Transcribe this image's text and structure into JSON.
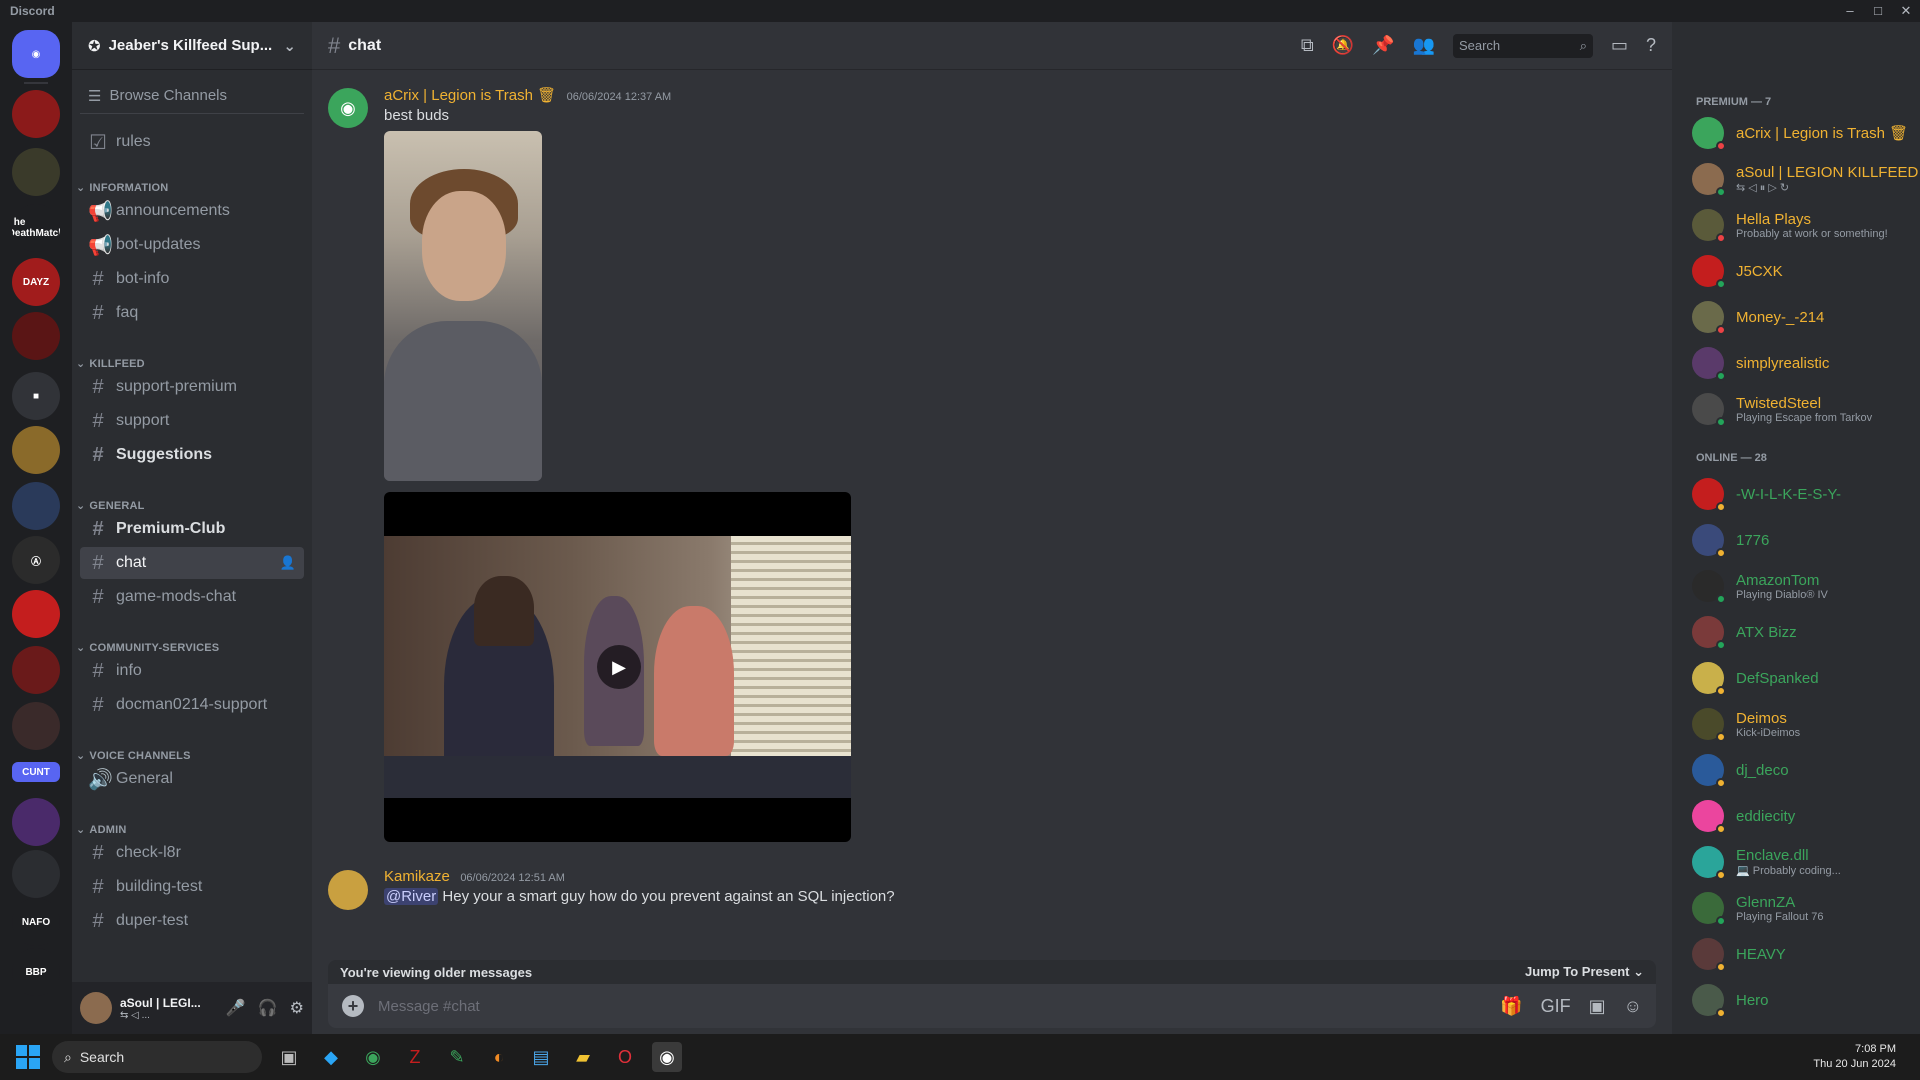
{
  "window": {
    "app_name": "Discord",
    "controls": [
      "–",
      "□",
      "✕"
    ]
  },
  "rail": {
    "servers": [
      {
        "name": "home",
        "label": "◉",
        "color": "#5865f2"
      },
      {
        "name": "server-1",
        "label": "",
        "color": "#8b1a1a"
      },
      {
        "name": "server-2",
        "label": "",
        "color": "#3a3a2a"
      },
      {
        "name": "server-3",
        "label": "The DeathMatch",
        "color": "#1e1f22"
      },
      {
        "name": "server-4",
        "label": "DAYZ",
        "color": "#a11c1c"
      },
      {
        "name": "server-5",
        "label": "",
        "color": "#5a1515"
      },
      {
        "name": "folder",
        "label": "■",
        "color": "#313338"
      },
      {
        "name": "server-6",
        "label": "",
        "color": "#8a6a2a"
      },
      {
        "name": "server-7",
        "label": "",
        "color": "#2a3a5a"
      },
      {
        "name": "server-8",
        "label": "Ⓐ",
        "color": "#2b2b2b"
      },
      {
        "name": "server-9",
        "label": "",
        "color": "#c41e1e"
      },
      {
        "name": "server-10",
        "label": "",
        "color": "#6a1a1a"
      },
      {
        "name": "server-11",
        "label": "",
        "color": "#3a2a2a"
      },
      {
        "name": "server-12",
        "label": "CUNT",
        "color": "#5865f2"
      },
      {
        "name": "server-13",
        "label": "",
        "color": "#4a2a6a"
      },
      {
        "name": "server-14",
        "label": "",
        "color": "#2b2d31"
      },
      {
        "name": "server-15",
        "label": "NAFO",
        "color": "#1e1f22"
      },
      {
        "name": "server-16",
        "label": "BBP",
        "color": "#1e1f22"
      }
    ]
  },
  "sidebar": {
    "guild_name": "Jeaber's Killfeed Sup...",
    "browse_channels": "Browse Channels",
    "rules": "rules",
    "categories": {
      "information": "INFORMATION",
      "killfeed": "KILLFEED",
      "general": "GENERAL",
      "community": "COMMUNITY-SERVICES",
      "voice": "VOICE CHANNELS",
      "admin": "ADMIN"
    },
    "channels": {
      "announcements": "announcements",
      "bot_updates": "bot-updates",
      "bot_info": "bot-info",
      "faq": "faq",
      "support_premium": "support-premium",
      "support": "support",
      "suggestions": "Suggestions",
      "premium_club": "Premium-Club",
      "chat": "chat",
      "game_mods_chat": "game-mods-chat",
      "info": "info",
      "docman": "docman0214-support",
      "voice_general": "General",
      "check_l8r": "check-l8r",
      "building_test": "building-test",
      "duper_test": "duper-test"
    }
  },
  "user_panel": {
    "name": "aSoul | LEGI...",
    "status": "⇆ ◁ ..."
  },
  "header": {
    "channel": "chat",
    "search_placeholder": "Search"
  },
  "messages": [
    {
      "author": "aCrix | Legion is Trash 🗑",
      "author_color": "#f0b232",
      "timestamp": "06/06/2024 12:37 AM",
      "text": "best buds"
    },
    {
      "author": "Kamikaze",
      "author_color": "#f0b232",
      "timestamp": "06/06/2024 12:51 AM",
      "mention": "@River",
      "text": "Hey your a smart guy how do you prevent against an SQL injection?"
    }
  ],
  "composer": {
    "older_notice": "You're viewing older messages",
    "jump": "Jump To Present",
    "placeholder": "Message #chat"
  },
  "members": {
    "premium_header": "PREMIUM — 7",
    "online_header": "ONLINE — 28",
    "premium": [
      {
        "name": "aCrix | Legion is Trash 🗑",
        "sub": "",
        "color": "#f0b232",
        "av": "#3ba55c",
        "status": "#ed4245"
      },
      {
        "name": "aSoul | LEGION KILLFEED",
        "sub": "⇆   ◁   ⏸   ▷   ↻",
        "color": "#f0b232",
        "av": "#8b6b4f",
        "status": "#23a55a"
      },
      {
        "name": "Hella Plays",
        "sub": "Probably at work or something!",
        "color": "#f0b232",
        "av": "#5a5a3a",
        "status": "#ed4245"
      },
      {
        "name": "J5CXK",
        "sub": "",
        "color": "#f0b232",
        "av": "#c41e1e",
        "status": "#23a55a"
      },
      {
        "name": "Money-_-214",
        "sub": "",
        "color": "#f0b232",
        "av": "#6a6a4a",
        "status": "#ed4245"
      },
      {
        "name": "simplyrealistic",
        "sub": "",
        "color": "#f0b232",
        "av": "#5a3a6a",
        "status": "#23a55a"
      },
      {
        "name": "TwistedSteel",
        "sub": "Playing Escape from Tarkov",
        "color": "#f0b232",
        "av": "#4a4a4a",
        "status": "#23a55a"
      }
    ],
    "online": [
      {
        "name": "-W-I-L-K-E-S-Y-",
        "sub": "",
        "color": "#3ba55c",
        "av": "#c41e1e",
        "status": "#f0b232"
      },
      {
        "name": "1776",
        "sub": "",
        "color": "#3ba55c",
        "av": "#3a4a7a",
        "status": "#f0b232"
      },
      {
        "name": "AmazonTom",
        "sub": "Playing Diablo® IV",
        "color": "#3ba55c",
        "av": "#2a2a2a",
        "status": "#23a55a"
      },
      {
        "name": "ATX Bizz",
        "sub": "",
        "color": "#3ba55c",
        "av": "#7a3a3a",
        "status": "#23a55a"
      },
      {
        "name": "DefSpanked",
        "sub": "",
        "color": "#3ba55c",
        "av": "#c9b04a",
        "status": "#f0b232"
      },
      {
        "name": "Deimos",
        "sub": "Kick-iDeimos",
        "color": "#f0b232",
        "av": "#4a4a2a",
        "status": "#f0b232"
      },
      {
        "name": "dj_deco",
        "sub": "",
        "color": "#3ba55c",
        "av": "#2a5a9a",
        "status": "#f0b232"
      },
      {
        "name": "eddiecity",
        "sub": "",
        "color": "#3ba55c",
        "av": "#eb459e",
        "status": "#f0b232"
      },
      {
        "name": "Enclave.dll",
        "sub": "💻 Probably coding...",
        "color": "#3ba55c",
        "av": "#2aa59a",
        "status": "#f0b232"
      },
      {
        "name": "GlennZA",
        "sub": "Playing Fallout 76",
        "color": "#3ba55c",
        "av": "#3a6a3a",
        "status": "#23a55a"
      },
      {
        "name": "HEAVY",
        "sub": "",
        "color": "#3ba55c",
        "av": "#5a3a3a",
        "status": "#f0b232"
      },
      {
        "name": "Hero",
        "sub": "",
        "color": "#3ba55c",
        "av": "#4a5a4a",
        "status": "#f0b232"
      }
    ]
  },
  "taskbar": {
    "search": "Search",
    "time": "7:08 PM",
    "date": "Thu 20 Jun 2024"
  }
}
